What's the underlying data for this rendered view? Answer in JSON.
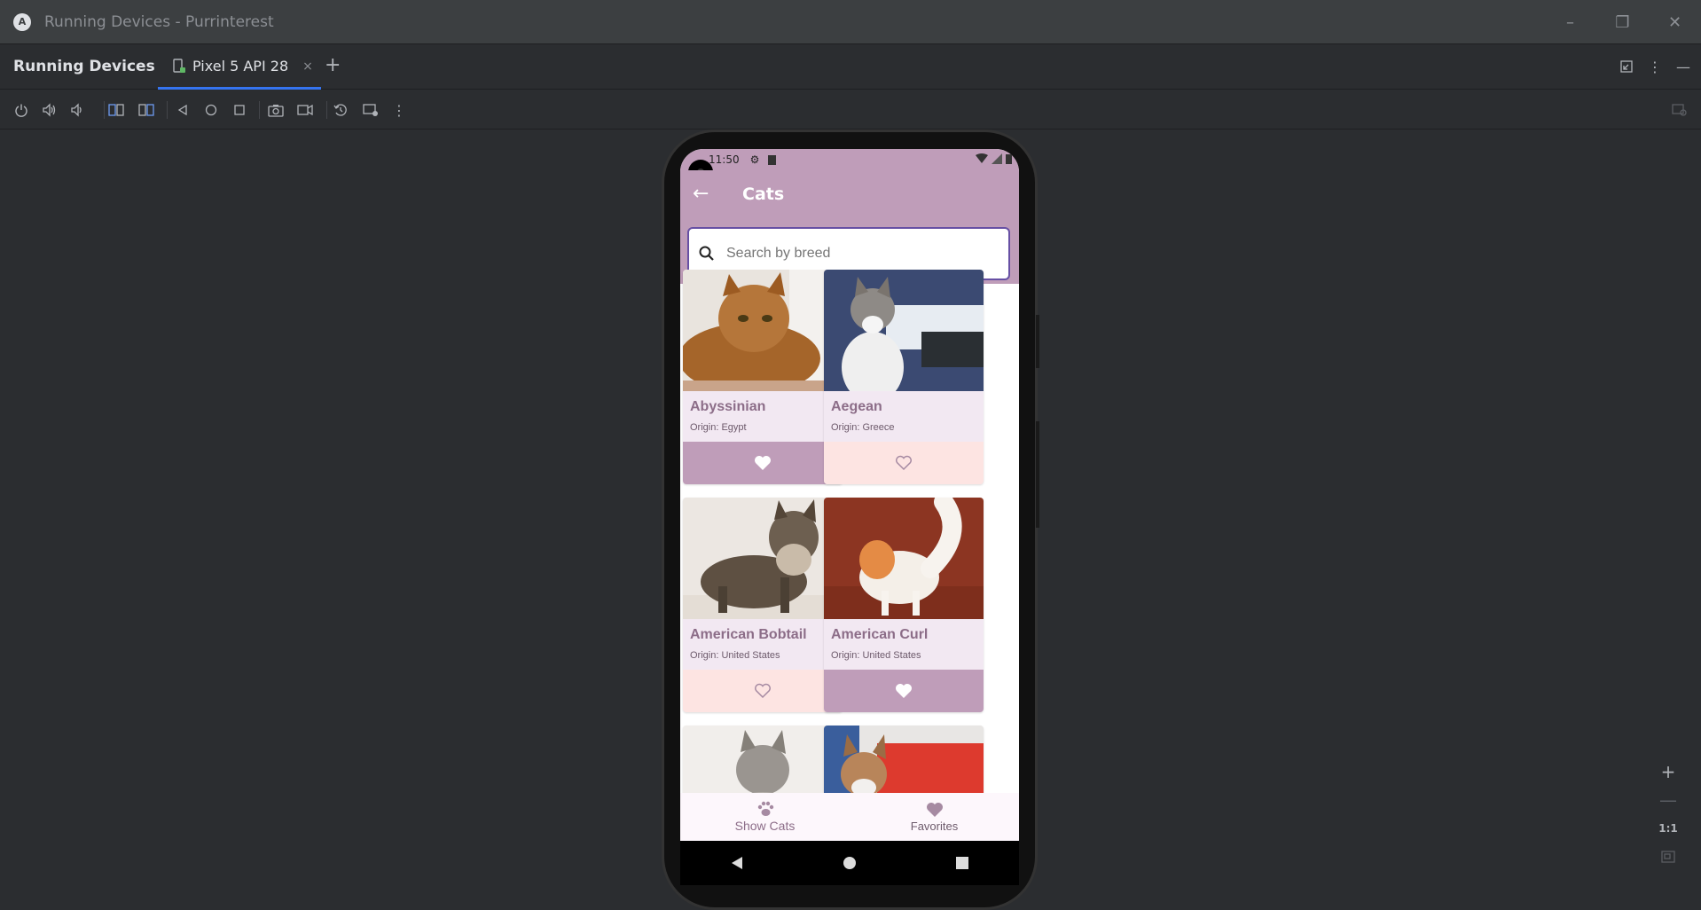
{
  "window": {
    "title": "Running Devices - Purrinterest"
  },
  "panel": {
    "title": "Running Devices"
  },
  "tab": {
    "label": "Pixel 5 API 28",
    "close": "×",
    "add": "+"
  },
  "device": {
    "status_time": "11:50",
    "app_title": "Cats",
    "search": {
      "placeholder": "Search by breed",
      "value": ""
    },
    "cats": [
      {
        "name": "Abyssinian",
        "origin": "Origin: Egypt",
        "favorite": true
      },
      {
        "name": "Aegean",
        "origin": "Origin: Greece",
        "favorite": false
      },
      {
        "name": "American Bobtail",
        "origin": "Origin: United States",
        "favorite": false
      },
      {
        "name": "American Curl",
        "origin": "Origin: United States",
        "favorite": true
      }
    ],
    "nav": {
      "show_cats": "Show Cats",
      "favorites": "Favorites"
    }
  },
  "zoom": {
    "reset_label": "1:1"
  },
  "colors": {
    "app_bar": "#bf9db9",
    "accent": "#6750a4",
    "fav_on": "#bf9db9",
    "fav_off": "#fde4e2"
  }
}
